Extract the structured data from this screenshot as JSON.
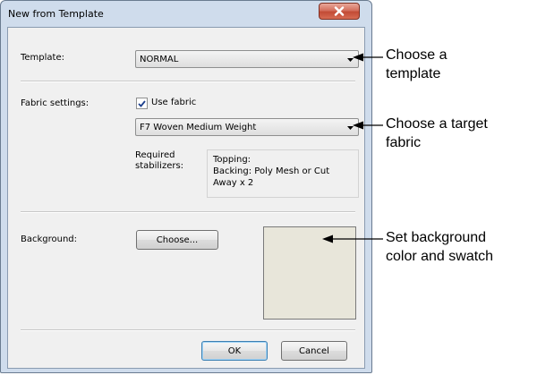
{
  "window": {
    "title": "New from Template"
  },
  "template": {
    "label": "Template:",
    "value": "NORMAL"
  },
  "fabric": {
    "label": "Fabric settings:",
    "use_fabric_label": "Use fabric",
    "use_fabric_checked": true,
    "value": "F7 Woven Medium Weight"
  },
  "stabilizers": {
    "label_line1": "Required",
    "label_line2": "stabilizers:",
    "line1": "Topping:",
    "line2": "Backing: Poly Mesh or Cut",
    "line3": "Away x 2"
  },
  "background": {
    "label": "Background:",
    "choose_button": "Choose...",
    "swatch_color": "#e8e6da"
  },
  "buttons": {
    "ok": "OK",
    "cancel": "Cancel"
  },
  "callouts": {
    "template": {
      "line1": "Choose a",
      "line2": "template"
    },
    "fabric": {
      "line1": "Choose a target",
      "line2": "fabric"
    },
    "background": {
      "line1": "Set background",
      "line2": "color and swatch"
    }
  },
  "icons": {
    "close": "close-icon",
    "dropdown": "chevron-down-icon",
    "checkmark": "checkmark-icon"
  }
}
